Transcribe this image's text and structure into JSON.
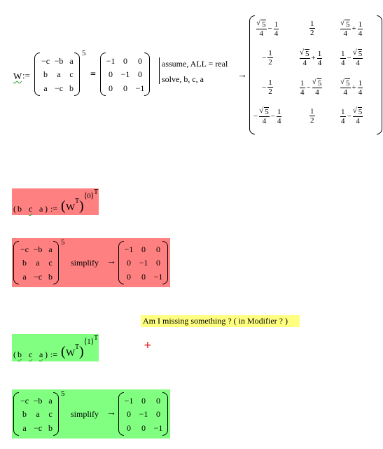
{
  "top_equation": {
    "lhs_var": "W",
    "assign_op": ":=",
    "matrix_left": [
      [
        "−c",
        "−b",
        "a"
      ],
      [
        "b",
        "a",
        "c"
      ],
      [
        "a",
        "−c",
        "b"
      ]
    ],
    "exponent": "5",
    "equals": "=",
    "matrix_right": [
      [
        "−1",
        "0",
        "0"
      ],
      [
        "0",
        "−1",
        "0"
      ],
      [
        "0",
        "0",
        "−1"
      ]
    ],
    "modifiers": [
      "assume, ALL = real",
      "solve, b, c, a"
    ],
    "arrow": "→",
    "result_rows": [
      [
        {
          "type": "sqrt_minus",
          "sqrt": "5",
          "d1": "4",
          "op": "−",
          "n2": "1",
          "d2": "4"
        },
        {
          "type": "frac",
          "n": "1",
          "d": "2"
        },
        {
          "type": "sqrt_plus",
          "sqrt": "5",
          "d1": "4",
          "op": "+",
          "n2": "1",
          "d2": "4"
        }
      ],
      [
        {
          "type": "neg_frac",
          "n": "1",
          "d": "2"
        },
        {
          "type": "sqrt_plus",
          "sqrt": "5",
          "d1": "4",
          "op": "+",
          "n2": "1",
          "d2": "4"
        },
        {
          "type": "frac_minus_sqrt",
          "n1": "1",
          "d1": "4",
          "op": "−",
          "sqrt": "5",
          "d2": "4"
        }
      ],
      [
        {
          "type": "neg_frac",
          "n": "1",
          "d": "2"
        },
        {
          "type": "frac_minus_sqrt",
          "n1": "1",
          "d1": "4",
          "op": "−",
          "sqrt": "5",
          "d2": "4"
        },
        {
          "type": "sqrt_plus",
          "sqrt": "5",
          "d1": "4",
          "op": "+",
          "n2": "1",
          "d2": "4"
        }
      ],
      [
        {
          "type": "neg_sqrt_minus",
          "sqrt": "5",
          "d1": "4",
          "op": "−",
          "n2": "1",
          "d2": "4"
        },
        {
          "type": "frac",
          "n": "1",
          "d": "2"
        },
        {
          "type": "frac_minus_sqrt",
          "n1": "1",
          "d1": "4",
          "op": "−",
          "sqrt": "5",
          "d2": "4"
        }
      ]
    ]
  },
  "red_assign": {
    "lhs": [
      "b",
      "c",
      "a"
    ],
    "assign_op": ":=",
    "base": "W",
    "transpose": "T",
    "column_index": "⟨0⟩",
    "outer_transpose": "T",
    "bg_color": "#ff8080"
  },
  "red_simplify": {
    "matrix_left": [
      [
        "−c",
        "−b",
        "a"
      ],
      [
        "b",
        "a",
        "c"
      ],
      [
        "a",
        "−c",
        "b"
      ]
    ],
    "exponent": "5",
    "keyword": "simplify",
    "arrow": "→",
    "matrix_right": [
      [
        "−1",
        "0",
        "0"
      ],
      [
        "0",
        "−1",
        "0"
      ],
      [
        "0",
        "0",
        "−1"
      ]
    ],
    "bg_color": "#ff8080"
  },
  "comment": {
    "text": "Am I missing something ? ( in Modifier ? )",
    "bg_color": "#ffff80"
  },
  "cursor": {
    "glyph": "+",
    "color": "#e00000"
  },
  "green_assign": {
    "lhs": [
      "b",
      "c",
      "a"
    ],
    "assign_op": ":=",
    "base": "W",
    "transpose": "T",
    "column_index": "⟨1⟩",
    "outer_transpose": "T",
    "bg_color": "#80ff80"
  },
  "green_simplify": {
    "matrix_left": [
      [
        "−c",
        "−b",
        "a"
      ],
      [
        "b",
        "a",
        "c"
      ],
      [
        "a",
        "−c",
        "b"
      ]
    ],
    "exponent": "5",
    "keyword": "simplify",
    "arrow": "→",
    "matrix_right": [
      [
        "−1",
        "0",
        "0"
      ],
      [
        "0",
        "−1",
        "0"
      ],
      [
        "0",
        "0",
        "−1"
      ]
    ],
    "bg_color": "#80ff80"
  }
}
